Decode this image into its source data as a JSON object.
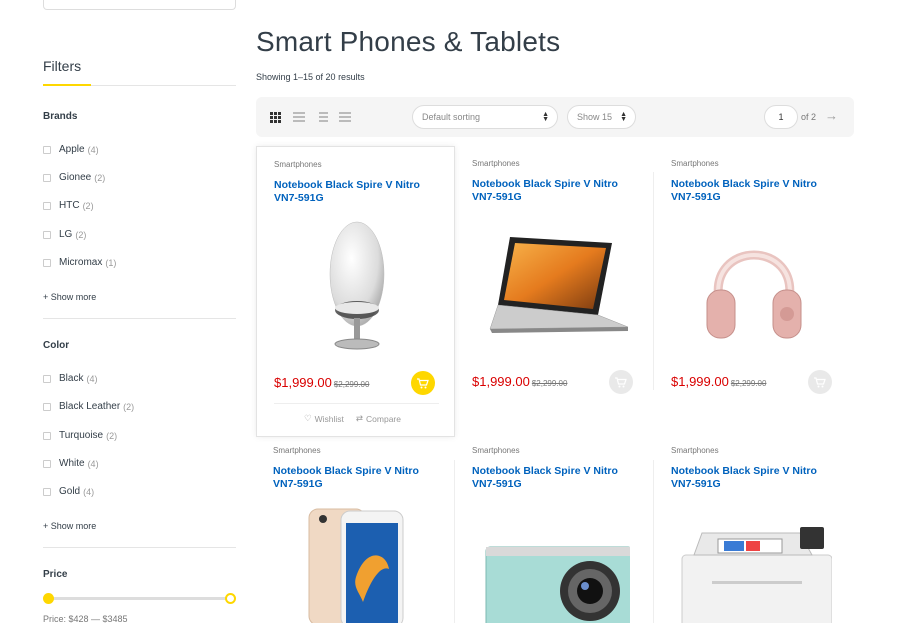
{
  "sidebar": {
    "filters_title": "Filters",
    "brands": {
      "title": "Brands",
      "items": [
        {
          "label": "Apple",
          "count": "(4)"
        },
        {
          "label": "Gionee",
          "count": "(2)"
        },
        {
          "label": "HTC",
          "count": "(2)"
        },
        {
          "label": "LG",
          "count": "(2)"
        },
        {
          "label": "Micromax",
          "count": "(1)"
        }
      ],
      "show_more": "+ Show more"
    },
    "color": {
      "title": "Color",
      "items": [
        {
          "label": "Black",
          "count": "(4)"
        },
        {
          "label": "Black Leather",
          "count": "(2)"
        },
        {
          "label": "Turquoise",
          "count": "(2)"
        },
        {
          "label": "White",
          "count": "(4)"
        },
        {
          "label": "Gold",
          "count": "(4)"
        }
      ],
      "show_more": "+ Show more"
    },
    "price": {
      "title": "Price",
      "range_text": "Price: $428 — $3485",
      "slider_low": 0,
      "slider_high": 1
    }
  },
  "main": {
    "title": "Smart Phones & Tablets",
    "results": "Showing 1–15 of 20 results",
    "toolbar": {
      "sorting": "Default sorting",
      "show": "Show 15",
      "page": "1",
      "of_pages": "of 2",
      "next": "→"
    },
    "products": [
      {
        "category": "Smartphones",
        "name": "Notebook Black Spire V Nitro VN7-591G",
        "price": "$1,999.00",
        "old_price": "$2,299.00",
        "image": "speaker",
        "wishlist": "Wishlist",
        "compare": "Compare"
      },
      {
        "category": "Smartphones",
        "name": "Notebook Black Spire V Nitro VN7-591G",
        "price": "$1,999.00",
        "old_price": "$2,299.00",
        "image": "laptop"
      },
      {
        "category": "Smartphones",
        "name": "Notebook Black Spire V Nitro VN7-591G",
        "price": "$1,999.00",
        "old_price": "$2,299.00",
        "image": "headphones"
      },
      {
        "category": "Smartphones",
        "name": "Notebook Black Spire V Nitro VN7-591G",
        "image": "iphone"
      },
      {
        "category": "Smartphones",
        "name": "Notebook Black Spire V Nitro VN7-591G",
        "image": "camera"
      },
      {
        "category": "Smartphones",
        "name": "Notebook Black Spire V Nitro VN7-591G",
        "image": "printer"
      }
    ]
  },
  "colors": {
    "accent": "#fed700",
    "link": "#0062bd",
    "price": "#d90000",
    "text": "#333e48"
  }
}
